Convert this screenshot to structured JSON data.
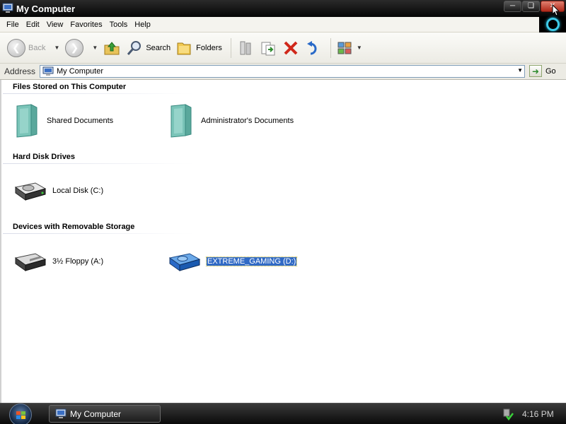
{
  "window": {
    "title": "My Computer",
    "icon": "my-computer-icon"
  },
  "title_controls": {
    "minimize": "minimize-icon",
    "maximize": "restore-icon",
    "close": "close-icon"
  },
  "menu": {
    "items": [
      {
        "label": "File",
        "key": "F"
      },
      {
        "label": "Edit",
        "key": "E"
      },
      {
        "label": "View",
        "key": "V"
      },
      {
        "label": "Favorites",
        "key": "a"
      },
      {
        "label": "Tools",
        "key": "T"
      },
      {
        "label": "Help",
        "key": "H"
      }
    ]
  },
  "toolbar": {
    "back_label": "Back",
    "search_label": "Search",
    "folders_label": "Folders"
  },
  "address": {
    "label": "Address",
    "value": "My Computer",
    "go_label": "Go"
  },
  "groups": {
    "files_header": "Files Stored on This Computer",
    "hdd_header": "Hard Disk Drives",
    "removable_header": "Devices with Removable Storage"
  },
  "items": {
    "shared_documents": "Shared Documents",
    "admin_documents": "Administrator's Documents",
    "local_disk": "Local Disk (C:)",
    "floppy": "3½ Floppy (A:)",
    "extreme_gaming": "EXTREME_GAMING (D:)"
  },
  "taskbar": {
    "task_label": "My Computer",
    "clock": "4:16 PM"
  },
  "colors": {
    "selection": "#316ac5",
    "accent_ring": "#3ecbe8",
    "close_button": "#c0392b"
  }
}
